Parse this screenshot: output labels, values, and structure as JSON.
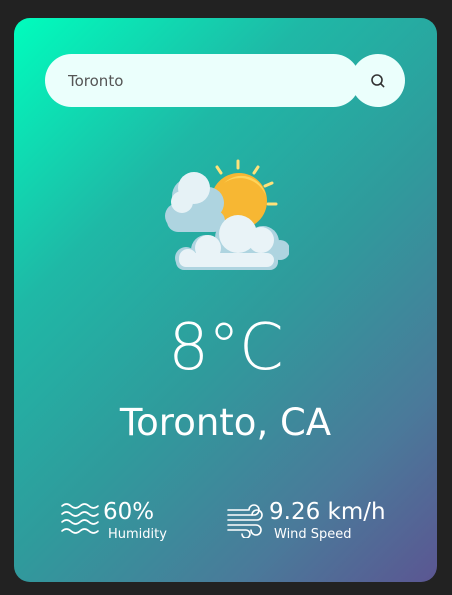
{
  "search": {
    "value": "Toronto",
    "placeholder": "",
    "button_icon": "search-icon"
  },
  "weather": {
    "icon": "partly-cloudy-icon",
    "temperature": "8°C",
    "location": "Toronto, CA"
  },
  "stats": {
    "humidity": {
      "icon": "humidity-waves-icon",
      "value": "60%",
      "label": "Humidity"
    },
    "wind": {
      "icon": "wind-icon",
      "value": "9.26 km/h",
      "label": "Wind Speed"
    }
  },
  "colors": {
    "background": "#222222",
    "gradient_start": "#00fdbd",
    "gradient_end": "#5b5692",
    "input_bg": "#ebfffc",
    "text": "#ffffff",
    "sun": "#f7b733",
    "cloud": "#dfeff5"
  }
}
